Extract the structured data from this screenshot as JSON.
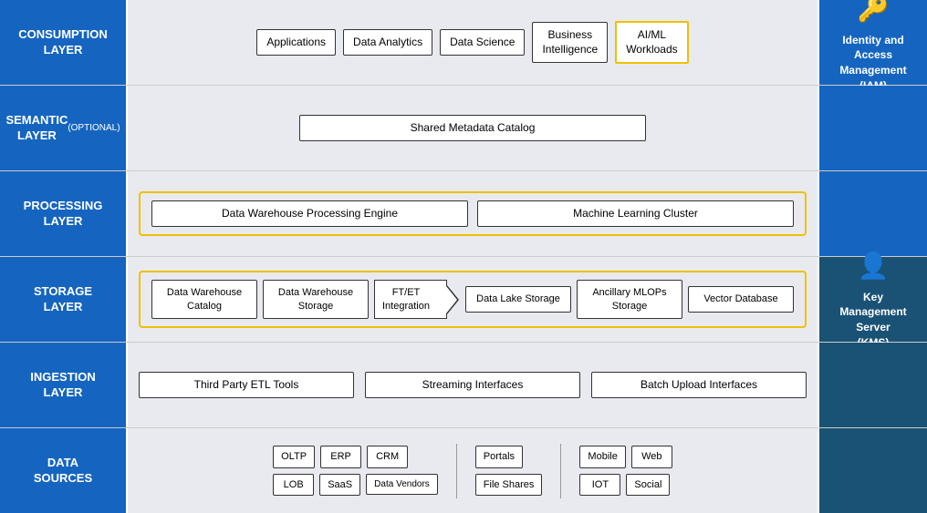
{
  "layers": {
    "consumption": {
      "label": "CONSUMPTION\nLAYER",
      "boxes": [
        {
          "id": "applications",
          "text": "Applications",
          "highlight": false
        },
        {
          "id": "data-analytics",
          "text": "Data Analytics",
          "highlight": false
        },
        {
          "id": "data-science",
          "text": "Data Science",
          "highlight": false
        },
        {
          "id": "business-intelligence",
          "text": "Business Intelligence",
          "highlight": false
        },
        {
          "id": "aiml-workloads",
          "text": "AI/ML Workloads",
          "highlight": true
        }
      ]
    },
    "semantic": {
      "label": "SEMANTIC\nLAYER\n(OPTIONAL)",
      "box": "Shared Metadata Catalog"
    },
    "processing": {
      "label": "PROCESSING\nLAYER",
      "boxes": [
        {
          "id": "dw-processing",
          "text": "Data Warehouse Processing Engine"
        },
        {
          "id": "ml-cluster",
          "text": "Machine Learning Cluster"
        }
      ]
    },
    "storage": {
      "label": "STORAGE\nLAYER",
      "boxes": [
        {
          "id": "dw-catalog",
          "text": "Data Warehouse Catalog"
        },
        {
          "id": "dw-storage",
          "text": "Data Warehouse Storage"
        },
        {
          "id": "ftet",
          "text": "FT/ET Integration",
          "arrow": true
        },
        {
          "id": "data-lake",
          "text": "Data Lake Storage"
        },
        {
          "id": "ancillary",
          "text": "Ancillary MLOPs Storage"
        },
        {
          "id": "vector-db",
          "text": "Vector Database"
        }
      ]
    },
    "ingestion": {
      "label": "INGESTION\nLAYER",
      "boxes": [
        {
          "id": "third-party-etl",
          "text": "Third Party ETL Tools"
        },
        {
          "id": "streaming",
          "text": "Streaming Interfaces"
        },
        {
          "id": "batch-upload",
          "text": "Batch Upload Interfaces"
        }
      ]
    },
    "sources": {
      "label": "DATA\nSOURCES",
      "groups": [
        {
          "rows": [
            [
              "OLTP",
              "ERP",
              "CRM"
            ],
            [
              "LOB",
              "SaaS",
              "Data Vendors"
            ]
          ]
        },
        {
          "rows": [
            [
              "Portals"
            ],
            [
              "File Shares"
            ]
          ]
        },
        {
          "rows": [
            [
              "Mobile",
              "Web"
            ],
            [
              "IOT",
              "Social"
            ]
          ]
        }
      ]
    }
  },
  "right_panels": {
    "iam": {
      "icon": "🔑",
      "label": "Identity and Access Management (IAM)",
      "rows": [
        "consumption",
        "semantic",
        "processing"
      ]
    },
    "kms": {
      "icon": "👤",
      "label": "Key Management Server (KMS)",
      "rows": [
        "storage",
        "ingestion",
        "sources"
      ]
    }
  }
}
